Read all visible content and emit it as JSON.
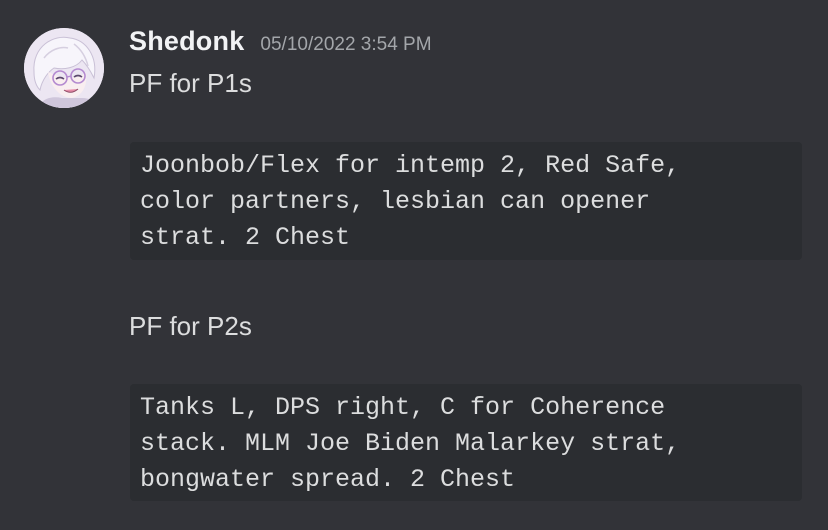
{
  "message": {
    "author": "Shedonk",
    "timestamp": "05/10/2022 3:54 PM",
    "avatar_icon": "anime-character-avatar",
    "line_1": "PF for P1s",
    "code_block_1": [
      "Joonbob/Flex for intemp 2, Red Safe,",
      "color partners, lesbian can opener",
      "strat. 2 Chest"
    ],
    "line_2": "PF for P2s",
    "code_block_2": [
      "Tanks L, DPS right, C for Coherence",
      "stack. MLM Joe Biden Malarkey strat,",
      "bongwater spread. 2 Chest"
    ]
  },
  "colors": {
    "background": "#323338",
    "code_background": "#2b2d31",
    "username": "#f2f3f5",
    "timestamp": "#a3a6aa",
    "text": "#dcddde"
  }
}
